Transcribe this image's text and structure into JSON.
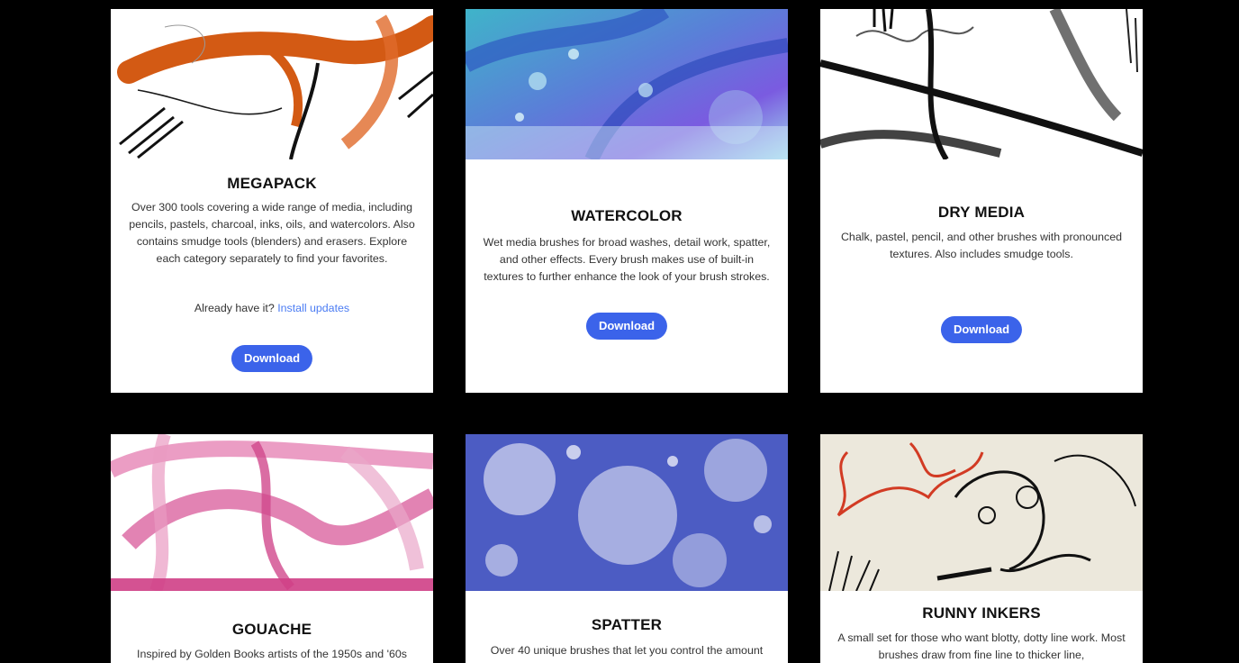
{
  "cards": [
    {
      "title": "MEGAPACK",
      "desc": "Over 300 tools covering a wide range of media, including pencils, pastels, charcoal, inks, oils, and watercolors. Also contains smudge tools (blenders) and erasers. Explore each category separately to find your favorites.",
      "already_text": "Already have it?",
      "already_link": "Install updates",
      "button": "Download",
      "image": "megapack-brush-strokes-image"
    },
    {
      "title": "WATERCOLOR",
      "desc": "Wet media brushes for broad washes, detail work, spatter, and other effects. Every brush makes use of built-in textures to further enhance the look of your brush strokes.",
      "button": "Download",
      "image": "watercolor-wash-image"
    },
    {
      "title": "DRY MEDIA",
      "desc": "Chalk, pastel, pencil, and other brushes with pronounced textures. Also includes smudge tools.",
      "button": "Download",
      "image": "dry-media-strokes-image"
    },
    {
      "title": "GOUACHE",
      "desc": "Inspired by Golden Books artists of the 1950s and '60s",
      "image": "gouache-pink-strokes-image"
    },
    {
      "title": "SPATTER",
      "desc": "Over 40 unique brushes that let you control the amount",
      "image": "spatter-blue-splatter-image"
    },
    {
      "title": "RUNNY INKERS",
      "desc": "A small set for those who want blotty, dotty line work. Most brushes draw from fine line to thicker line,",
      "image": "runny-inkers-script-image"
    }
  ],
  "colors": {
    "accent": "#3b63ea",
    "link": "#4b7cf3",
    "background": "#000000",
    "card": "#ffffff"
  }
}
